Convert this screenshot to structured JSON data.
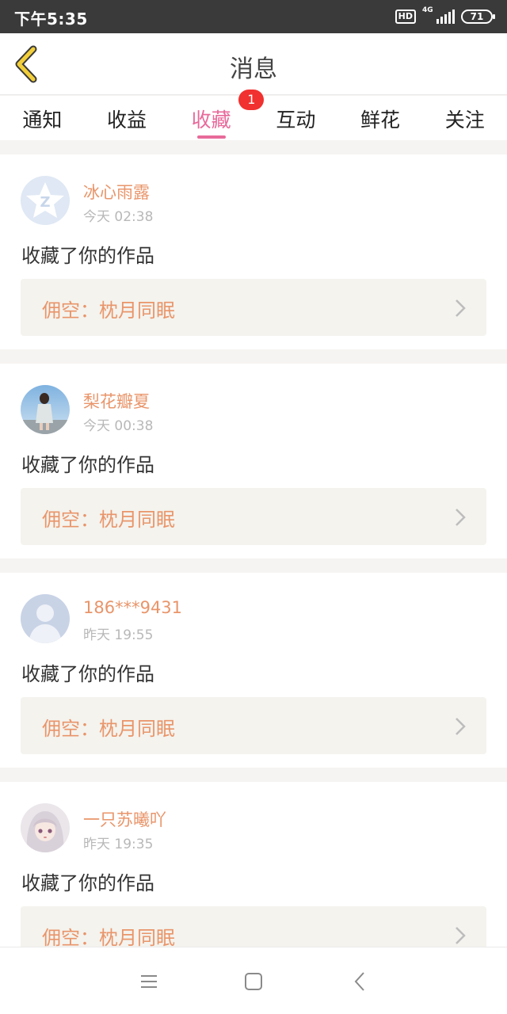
{
  "status_bar": {
    "time": "下午5:35",
    "hd": "HD",
    "network": "4G",
    "battery": "71"
  },
  "header": {
    "title": "消息"
  },
  "tabs": [
    {
      "label": "通知"
    },
    {
      "label": "收益"
    },
    {
      "label": "收藏",
      "badge": "1",
      "active": true
    },
    {
      "label": "互动"
    },
    {
      "label": "鲜花"
    },
    {
      "label": "关注"
    }
  ],
  "messages": [
    {
      "user": "冰心雨露",
      "time": "今天 02:38",
      "action": "收藏了你的作品",
      "work": "佣空：枕月同眠",
      "avatar": "qq-default-avatar"
    },
    {
      "user": "梨花瓣夏",
      "time": "今天 00:38",
      "action": "收藏了你的作品",
      "work": "佣空：枕月同眠",
      "avatar": "photo-avatar"
    },
    {
      "user": "186***9431",
      "time": "昨天 19:55",
      "action": "收藏了你的作品",
      "work": "佣空：枕月同眠",
      "avatar": "default-person-avatar"
    },
    {
      "user": "一只苏曦吖",
      "time": "昨天 19:35",
      "action": "收藏了你的作品",
      "work": "佣空：枕月同眠",
      "avatar": "anime-avatar"
    }
  ],
  "colors": {
    "accent": "#e86a9a",
    "username": "#e9956a",
    "badge": "#f0312f",
    "back_arrow": "#f2cf3a"
  }
}
